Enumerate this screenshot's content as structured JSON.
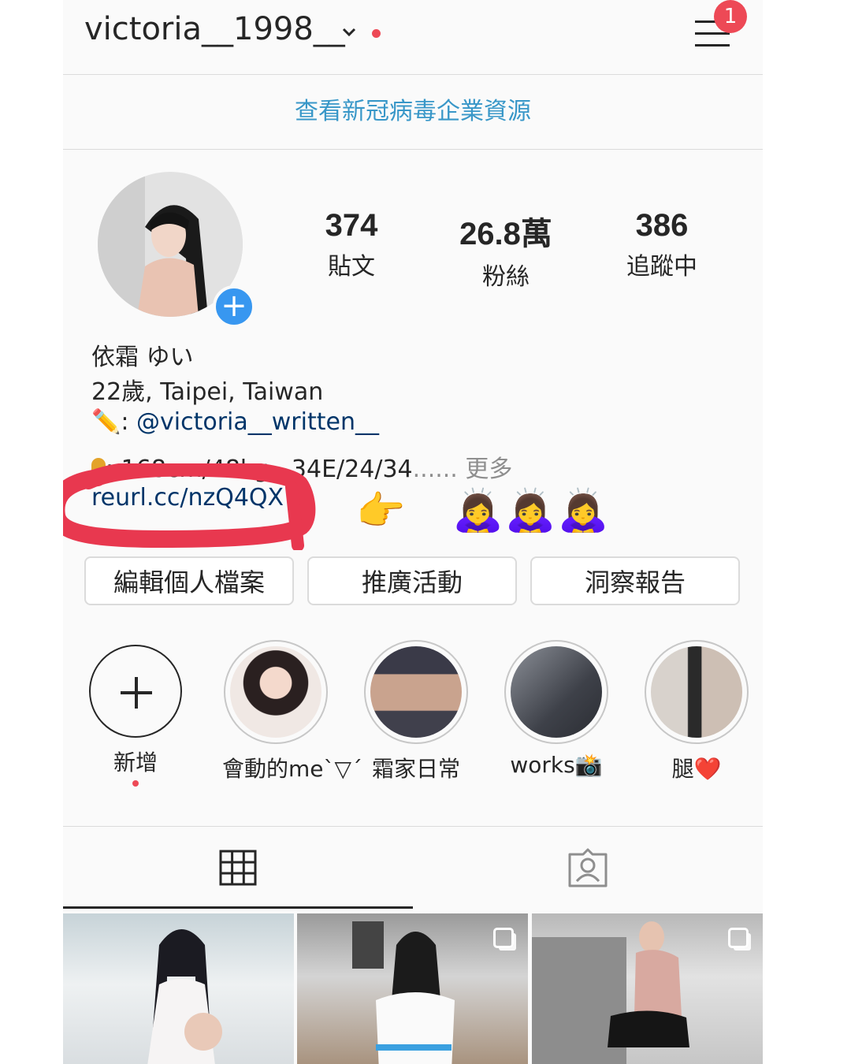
{
  "header": {
    "username": "victoria__1998__",
    "notification_count": "1"
  },
  "banner": {
    "covid_text": "查看新冠病毒企業資源"
  },
  "stats": [
    {
      "value": "374",
      "label": "貼文"
    },
    {
      "value": "26.8萬",
      "label": "粉絲"
    },
    {
      "value": "386",
      "label": "追蹤中"
    }
  ],
  "bio": {
    "name": "依霜 ゆい",
    "line1": "22歲, Taipei, Taiwan",
    "pen_emoji": "✏️",
    "mention_prefix": ": ",
    "mention": "@victoria__written__",
    "line3_text": ": 168cm/48kg , 34E/24/34",
    "line3_dots": "......",
    "more": "更多",
    "link": "reurl.cc/nzQ4QX",
    "point_emoji": "👉",
    "bow_emojis": "🙇‍♀️🙇‍♀️🙇‍♀️"
  },
  "buttons": {
    "edit_profile": "編輯個人檔案",
    "promotions": "推廣活動",
    "insights": "洞察報告"
  },
  "highlights": [
    {
      "label": "新增"
    },
    {
      "label": "會動的me`▽´"
    },
    {
      "label": "霜家日常"
    },
    {
      "label": "works📸"
    },
    {
      "label": "腿❤️"
    }
  ],
  "colors": {
    "accent_blue": "#3897f0",
    "link_blue": "#003569",
    "covid_blue": "#3897c8",
    "notification_red": "#ed4956",
    "annotation_red": "#e8384f"
  }
}
